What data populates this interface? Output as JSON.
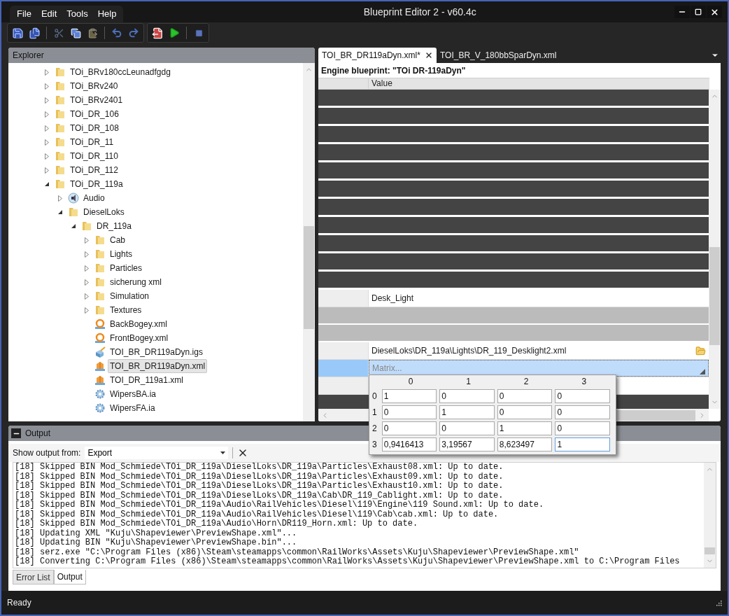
{
  "window": {
    "title": "Blueprint Editor 2 - v60.4c"
  },
  "menu": [
    "File",
    "Edit",
    "Tools",
    "Help"
  ],
  "explorer": {
    "title": "Explorer",
    "tree": [
      {
        "label": "TOi_BRv180ccLeunadfgdg",
        "kind": "folder",
        "expanded": false,
        "selected": false
      },
      {
        "label": "TOi_BRv240",
        "kind": "folder",
        "expanded": false,
        "selected": false
      },
      {
        "label": "TOi_BRv2401",
        "kind": "folder",
        "expanded": false,
        "selected": false
      },
      {
        "label": "TOi_DR_106",
        "kind": "folder",
        "expanded": false,
        "selected": false
      },
      {
        "label": "TOi_DR_108",
        "kind": "folder",
        "expanded": false,
        "selected": false
      },
      {
        "label": "TOi_DR_11",
        "kind": "folder",
        "expanded": false,
        "selected": false
      },
      {
        "label": "TOi_DR_110",
        "kind": "folder",
        "expanded": false,
        "selected": false
      },
      {
        "label": "TOi_DR_112",
        "kind": "folder",
        "expanded": false,
        "selected": false
      },
      {
        "label": "TOi_DR_119a",
        "kind": "folder",
        "expanded": true,
        "selected": false,
        "children": [
          {
            "label": "Audio",
            "kind": "audio",
            "expanded": false,
            "selected": false
          },
          {
            "label": "DieselLoks",
            "kind": "folder",
            "expanded": true,
            "selected": false,
            "children": [
              {
                "label": "DR_119a",
                "kind": "folder",
                "expanded": true,
                "selected": false,
                "children": [
                  {
                    "label": "Cab",
                    "kind": "folder",
                    "expanded": false,
                    "selected": false
                  },
                  {
                    "label": "Lights",
                    "kind": "folder",
                    "expanded": false,
                    "selected": false
                  },
                  {
                    "label": "Particles",
                    "kind": "folder",
                    "expanded": false,
                    "selected": false
                  },
                  {
                    "label": "sicherung xml",
                    "kind": "folder",
                    "expanded": false,
                    "selected": false
                  },
                  {
                    "label": "Simulation",
                    "kind": "folder",
                    "expanded": false,
                    "selected": false
                  },
                  {
                    "label": "Textures",
                    "kind": "folder",
                    "expanded": false,
                    "selected": false
                  },
                  {
                    "label": "BackBogey.xml",
                    "kind": "bogey",
                    "selected": false
                  },
                  {
                    "label": "FrontBogey.xml",
                    "kind": "bogey",
                    "selected": false
                  },
                  {
                    "label": "TOI_BR_DR119aDyn.igs",
                    "kind": "igs",
                    "selected": false
                  },
                  {
                    "label": "TOI_BR_DR119aDyn.xml",
                    "kind": "blueprint",
                    "selected": true
                  },
                  {
                    "label": "TOI_DR_119a1.xml",
                    "kind": "blueprint",
                    "selected": false
                  },
                  {
                    "label": "WipersBA.ia",
                    "kind": "gear",
                    "selected": false
                  },
                  {
                    "label": "WipersFA.ia",
                    "kind": "gear",
                    "selected": false
                  }
                ]
              }
            ]
          }
        ]
      }
    ]
  },
  "editor": {
    "tabs": [
      {
        "label": "TOI_BR_DR119aDyn.xml*",
        "selected": true
      },
      {
        "label": "TOI_BR_V_180bbSparDyn.xml",
        "selected": false
      }
    ],
    "heading": "Engine blueprint: \"TOi DR-119aDyn\"",
    "columns": [
      "Value"
    ],
    "rows": [
      {
        "kind": "dark"
      },
      {
        "kind": "dark"
      },
      {
        "kind": "dark"
      },
      {
        "kind": "dark"
      },
      {
        "kind": "dark"
      },
      {
        "kind": "dark"
      },
      {
        "kind": "dark"
      },
      {
        "kind": "dark"
      },
      {
        "kind": "dark"
      },
      {
        "kind": "dark"
      },
      {
        "kind": "dark"
      },
      {
        "kind": "text",
        "value": "Desk_Light",
        "selected": false
      },
      {
        "kind": "gray"
      },
      {
        "kind": "gray"
      },
      {
        "kind": "file",
        "value": "DieselLoks\\DR_119a\\Lights\\DR_119_Desklight2.xml",
        "selected": false
      },
      {
        "kind": "matrix",
        "value": "Matrix...",
        "selected": true
      },
      {
        "kind": "blank"
      },
      {
        "kind": "dark"
      }
    ],
    "matrix_editor": {
      "columns": [
        "0",
        "1",
        "2",
        "3"
      ],
      "rows": [
        {
          "label": "0",
          "cells": [
            {
              "value": "1",
              "focused": false
            },
            {
              "value": "0",
              "focused": false
            },
            {
              "value": "0",
              "focused": false
            },
            {
              "value": "0",
              "focused": false
            }
          ]
        },
        {
          "label": "1",
          "cells": [
            {
              "value": "0",
              "focused": false
            },
            {
              "value": "1",
              "focused": false
            },
            {
              "value": "0",
              "focused": false
            },
            {
              "value": "0",
              "focused": false
            }
          ]
        },
        {
          "label": "2",
          "cells": [
            {
              "value": "0",
              "focused": false
            },
            {
              "value": "0",
              "focused": false
            },
            {
              "value": "1",
              "focused": false
            },
            {
              "value": "0",
              "focused": false
            }
          ]
        },
        {
          "label": "3",
          "cells": [
            {
              "value": "0,9416413",
              "focused": false
            },
            {
              "value": "3,19567",
              "focused": false
            },
            {
              "value": "8,623497",
              "focused": false
            },
            {
              "value": "1",
              "focused": true
            }
          ]
        }
      ]
    }
  },
  "output": {
    "title": "Output",
    "source_label": "Show output from:",
    "source": "Export",
    "lines": [
      "[18] Skipped BIN Mod_Schmiede\\TOi_DR_119a\\DieselLoks\\DR_119a\\Particles\\Exhaust08.xml: Up to date.",
      "[18] Skipped BIN Mod_Schmiede\\TOi_DR_119a\\DieselLoks\\DR_119a\\Particles\\Exhaust09.xml: Up to date.",
      "[18] Skipped BIN Mod_Schmiede\\TOi_DR_119a\\DieselLoks\\DR_119a\\Particles\\Exhaust10.xml: Up to date.",
      "[18] Skipped BIN Mod_Schmiede\\TOi_DR_119a\\DieselLoks\\DR_119a\\Cab\\DR_119_Cablight.xml: Up to date.",
      "[18] Skipped BIN Mod_Schmiede\\TOi_DR_119a\\Audio\\RailVehicles\\Diesel\\119\\Engine\\119 Sound.xml: Up to date.",
      "[18] Skipped BIN Mod_Schmiede\\TOi_DR_119a\\Audio\\RailVehicles\\Diesel\\119\\Cab\\cab.xml: Up to date.",
      "[18] Skipped BIN Mod_Schmiede\\TOi_DR_119a\\Audio\\Horn\\DR119_Horn.xml: Up to date.",
      "[18] Updating XML \"Kuju\\Shapeviewer\\PreviewShape.xml\"...",
      "[18] Updating BIN \"Kuju\\Shapeviewer\\PreviewShape.bin\"...",
      "[18] serz.exe \"C:\\Program Files (x86)\\Steam\\steamapps\\common\\RailWorks\\Assets\\Kuju\\Shapeviewer\\PreviewShape.xml\"",
      "[18] Converting C:\\Program Files (x86)\\Steam\\steamapps\\common\\RailWorks\\Assets\\Kuju\\Shapeviewer\\PreviewShape.xml to C:\\Program Files"
    ],
    "tabs": [
      {
        "label": "Error List",
        "selected": false
      },
      {
        "label": "Output",
        "selected": true
      }
    ]
  },
  "status_bar": {
    "text": "Ready"
  }
}
